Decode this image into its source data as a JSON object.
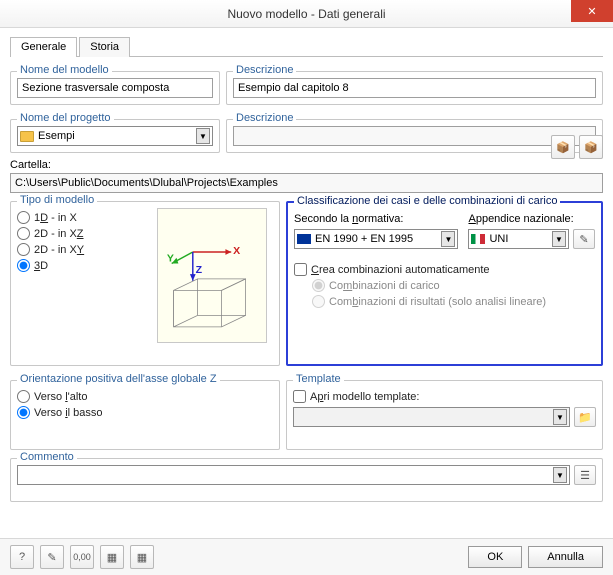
{
  "window": {
    "title": "Nuovo modello - Dati generali",
    "close_glyph": "✕"
  },
  "tabs": {
    "general": "Generale",
    "history": "Storia"
  },
  "model_name": {
    "legend": "Nome del modello",
    "value": "Sezione trasversale composta"
  },
  "desc1": {
    "legend": "Descrizione",
    "value": "Esempio dal capitolo 8"
  },
  "project_name": {
    "legend": "Nome del progetto",
    "value": "Esempi"
  },
  "desc2": {
    "legend": "Descrizione",
    "value": ""
  },
  "folder": {
    "label": "Cartella:",
    "value": "C:\\Users\\Public\\Documents\\Dlubal\\Projects\\Examples"
  },
  "model_type": {
    "legend": "Tipo di modello",
    "opt1_pre": "1",
    "opt1_u": "D",
    "opt1_post": " - in X",
    "opt2_pre": "2D - in X",
    "opt2_u": "Z",
    "opt3_pre": "2D - in X",
    "opt3_u": "Y",
    "opt4_u": "3",
    "opt4_post": "D"
  },
  "classification": {
    "legend": "Classificazione dei casi e delle combinazioni di carico",
    "standard_label_pre": "Secondo la ",
    "standard_label_u": "n",
    "standard_label_post": "ormativa:",
    "annex_label_u": "A",
    "annex_label_post": "ppendice nazionale:",
    "standard_value": "EN 1990 + EN 1995",
    "annex_value": "UNI",
    "auto_u": "C",
    "auto_post": "rea combinazioni automaticamente",
    "lc_pre": "Co",
    "lc_u": "m",
    "lc_post": "binazioni di carico",
    "rc_pre": "Com",
    "rc_u": "b",
    "rc_post": "inazioni di risultati (solo analisi lineare)"
  },
  "orientation": {
    "legend": "Orientazione positiva dell'asse globale Z",
    "up_pre": "Verso ",
    "up_u": "l",
    "up_post": "'alto",
    "down_pre": "Verso ",
    "down_u": "i",
    "down_post": "l basso"
  },
  "template": {
    "legend": "Template",
    "open_pre": "A",
    "open_u": "p",
    "open_post": "ri modello template:",
    "value": ""
  },
  "comment": {
    "legend": "Commento",
    "value": ""
  },
  "footer": {
    "ok": "OK",
    "cancel": "Annulla"
  }
}
